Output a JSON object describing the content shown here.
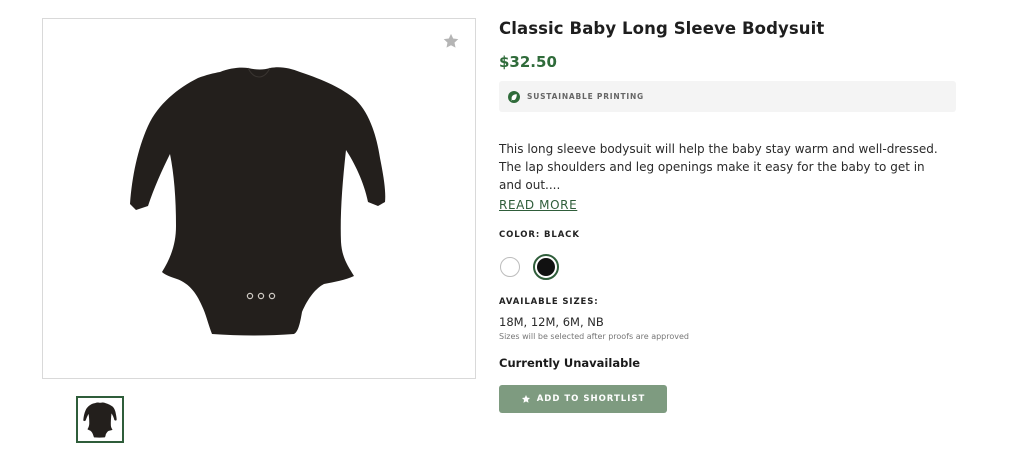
{
  "product": {
    "title": "Classic Baby Long Sleeve Bodysuit",
    "price": "$32.50",
    "badge": {
      "icon": "leaf-icon",
      "text": "SUSTAINABLE PRINTING"
    },
    "description": "This long sleeve bodysuit will help the baby stay warm and well-dressed. The lap shoulders and leg openings make it easy for the baby to get in and out....",
    "read_more": "READ MORE",
    "color_label": "COLOR: BLACK",
    "colors": [
      {
        "name": "white",
        "hex": "#ffffff",
        "selected": false
      },
      {
        "name": "black",
        "hex": "#111111",
        "selected": true
      }
    ],
    "sizes_label": "AVAILABLE SIZES:",
    "sizes_value": "18M, 12M, 6M, NB",
    "sizes_note": "Sizes will be selected after proofs are approved",
    "availability": "Currently Unavailable",
    "shortlist_label": "ADD TO SHORTLIST"
  },
  "icons": {
    "favorite": "star-icon",
    "shortlist": "star-icon"
  },
  "colors": {
    "accent_green": "#2f6b3a",
    "button_green": "#7e9b80",
    "garment": "#231f1c"
  }
}
